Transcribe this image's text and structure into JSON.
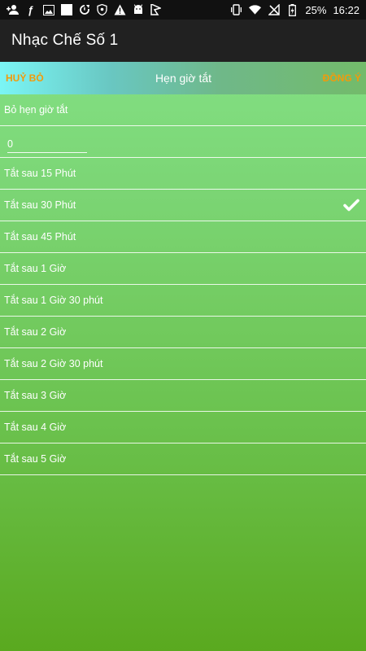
{
  "status_bar": {
    "battery": "25%",
    "time": "16:22",
    "left_icons": [
      "person-add-icon",
      "facebook-icon",
      "image-icon",
      "square-icon",
      "sync-icon",
      "shield-icon",
      "warning-icon",
      "android-icon",
      "flag-icon"
    ],
    "right_icons": [
      "vibrate-icon",
      "wifi-icon",
      "no-signal-icon",
      "battery-charging-icon"
    ]
  },
  "app_bar": {
    "title": "Nhạc Chế Số 1"
  },
  "dialog": {
    "cancel_label": "HUỶ BỎ",
    "title": "Hẹn giờ tắt",
    "ok_label": "ĐỒNG Ý",
    "cancel_timer_label": "Bỏ hẹn giờ tắt",
    "minutes_input_value": "0",
    "options": [
      {
        "label": "Tắt sau 15 Phút",
        "selected": false
      },
      {
        "label": "Tắt sau 30 Phút",
        "selected": true
      },
      {
        "label": "Tắt sau 45 Phút",
        "selected": false
      },
      {
        "label": "Tắt sau 1 Giờ",
        "selected": false
      },
      {
        "label": "Tắt sau 1 Giờ 30 phút",
        "selected": false
      },
      {
        "label": "Tắt sau 2 Giờ",
        "selected": false
      },
      {
        "label": "Tắt sau 2 Giờ 30 phút",
        "selected": false
      },
      {
        "label": "Tắt sau 3 Giờ",
        "selected": false
      },
      {
        "label": "Tắt sau 4 Giờ",
        "selected": false
      },
      {
        "label": "Tắt sau 5 Giờ",
        "selected": false
      }
    ]
  },
  "colors": {
    "accent": "#f39a0a",
    "app_bar": "#212121",
    "status_bar": "#111111"
  }
}
